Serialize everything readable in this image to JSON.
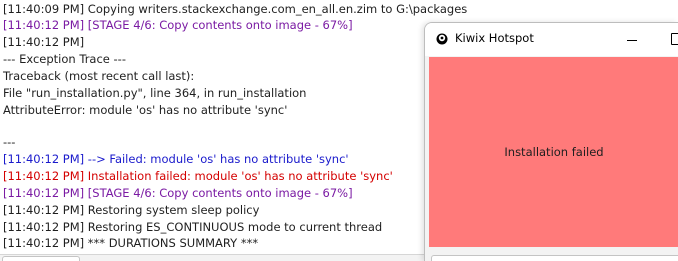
{
  "log": {
    "lines": [
      {
        "text": "[11:40:09 PM] Copying writers.stackexchange.com_en_all.en.zim to G:\\packages",
        "color": "default"
      },
      {
        "text": "[11:40:12 PM] [STAGE 4/6: Copy contents onto image - 67%]",
        "color": "purple"
      },
      {
        "text": "[11:40:12 PM]",
        "color": "default"
      },
      {
        "text": "--- Exception Trace ---",
        "color": "default"
      },
      {
        "text": "Traceback (most recent call last):",
        "color": "default"
      },
      {
        "text": "  File \"run_installation.py\", line 364, in run_installation",
        "color": "default"
      },
      {
        "text": "AttributeError: module 'os' has no attribute 'sync'",
        "color": "default"
      },
      {
        "text": "",
        "color": "default"
      },
      {
        "text": "---",
        "color": "default"
      },
      {
        "text": "[11:40:12 PM] --> Failed: module 'os' has no attribute 'sync'",
        "color": "blue"
      },
      {
        "text": "[11:40:12 PM] Installation failed: module 'os' has no attribute 'sync'",
        "color": "red"
      },
      {
        "text": "[11:40:12 PM] [STAGE 4/6: Copy contents onto image - 67%]",
        "color": "purple"
      },
      {
        "text": "[11:40:12 PM] Restoring system sleep policy",
        "color": "default"
      },
      {
        "text": "[11:40:12 PM] Restoring ES_CONTINUOUS mode to current thread",
        "color": "default"
      },
      {
        "text": "[11:40:12 PM] *** DURATIONS SUMMARY ***",
        "color": "default"
      }
    ],
    "colors": {
      "default": "#1f1f1f",
      "purple": "#7a1aa3",
      "blue": "#1a1acc",
      "red": "#d40000"
    }
  },
  "window": {
    "title": "Kiwix Hotspot",
    "icon": "kiwix-app-icon",
    "status_text": "Installation failed",
    "status_color": "#ff7a7a"
  }
}
